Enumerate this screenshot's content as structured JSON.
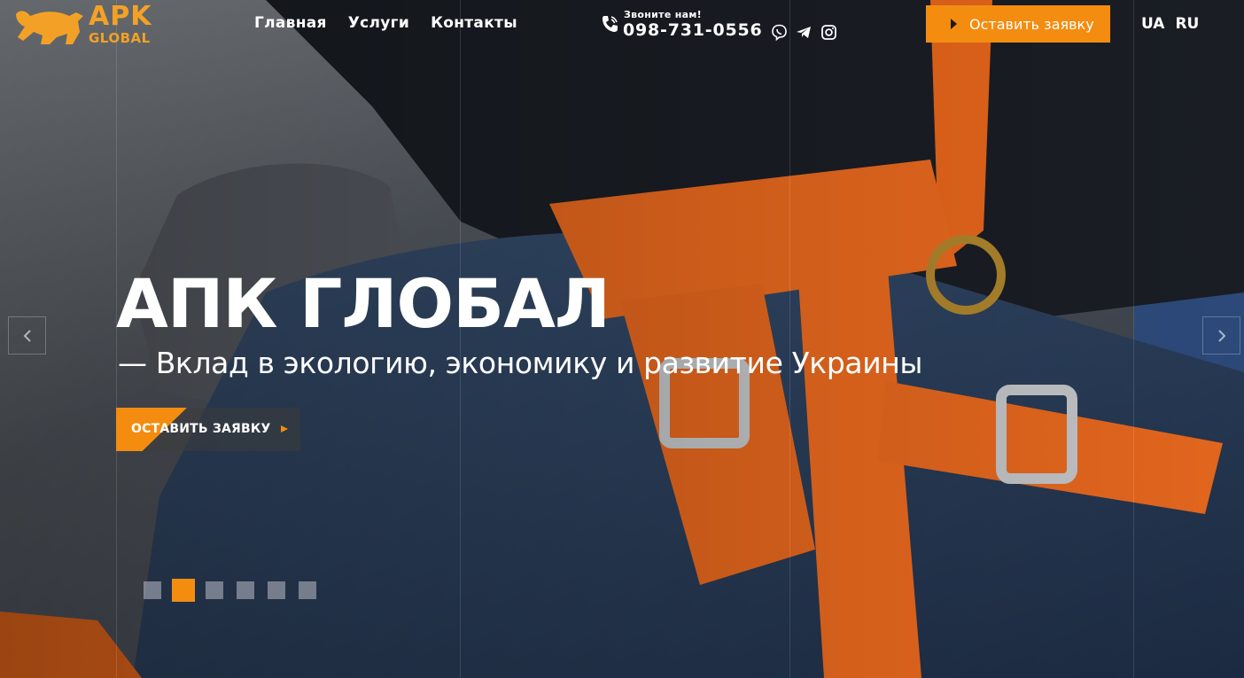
{
  "brand": {
    "logo_top": "APK",
    "logo_bottom": "GLOBAL",
    "accent_color": "#f48c10"
  },
  "nav": {
    "items": [
      "Главная",
      "Услуги",
      "Контакты"
    ]
  },
  "contact": {
    "caption": "Звоните нам!",
    "phone": "098-731-0556",
    "icon": "phone-icon",
    "socials": [
      "viber-icon",
      "telegram-icon",
      "instagram-icon"
    ]
  },
  "header_cta": {
    "label": "Оставить заявку"
  },
  "languages": [
    "UA",
    "RU"
  ],
  "hero": {
    "title": "АПК ГЛОБАЛ",
    "subtitle": "— Вклад в экологию, экономику и развитие Украины",
    "button_label": "ОСТАВИТЬ ЗАЯВКУ"
  },
  "slider": {
    "slide_count": 6,
    "active_slide": 2,
    "prev_icon": "chevron-left-icon",
    "next_icon": "chevron-right-icon"
  }
}
